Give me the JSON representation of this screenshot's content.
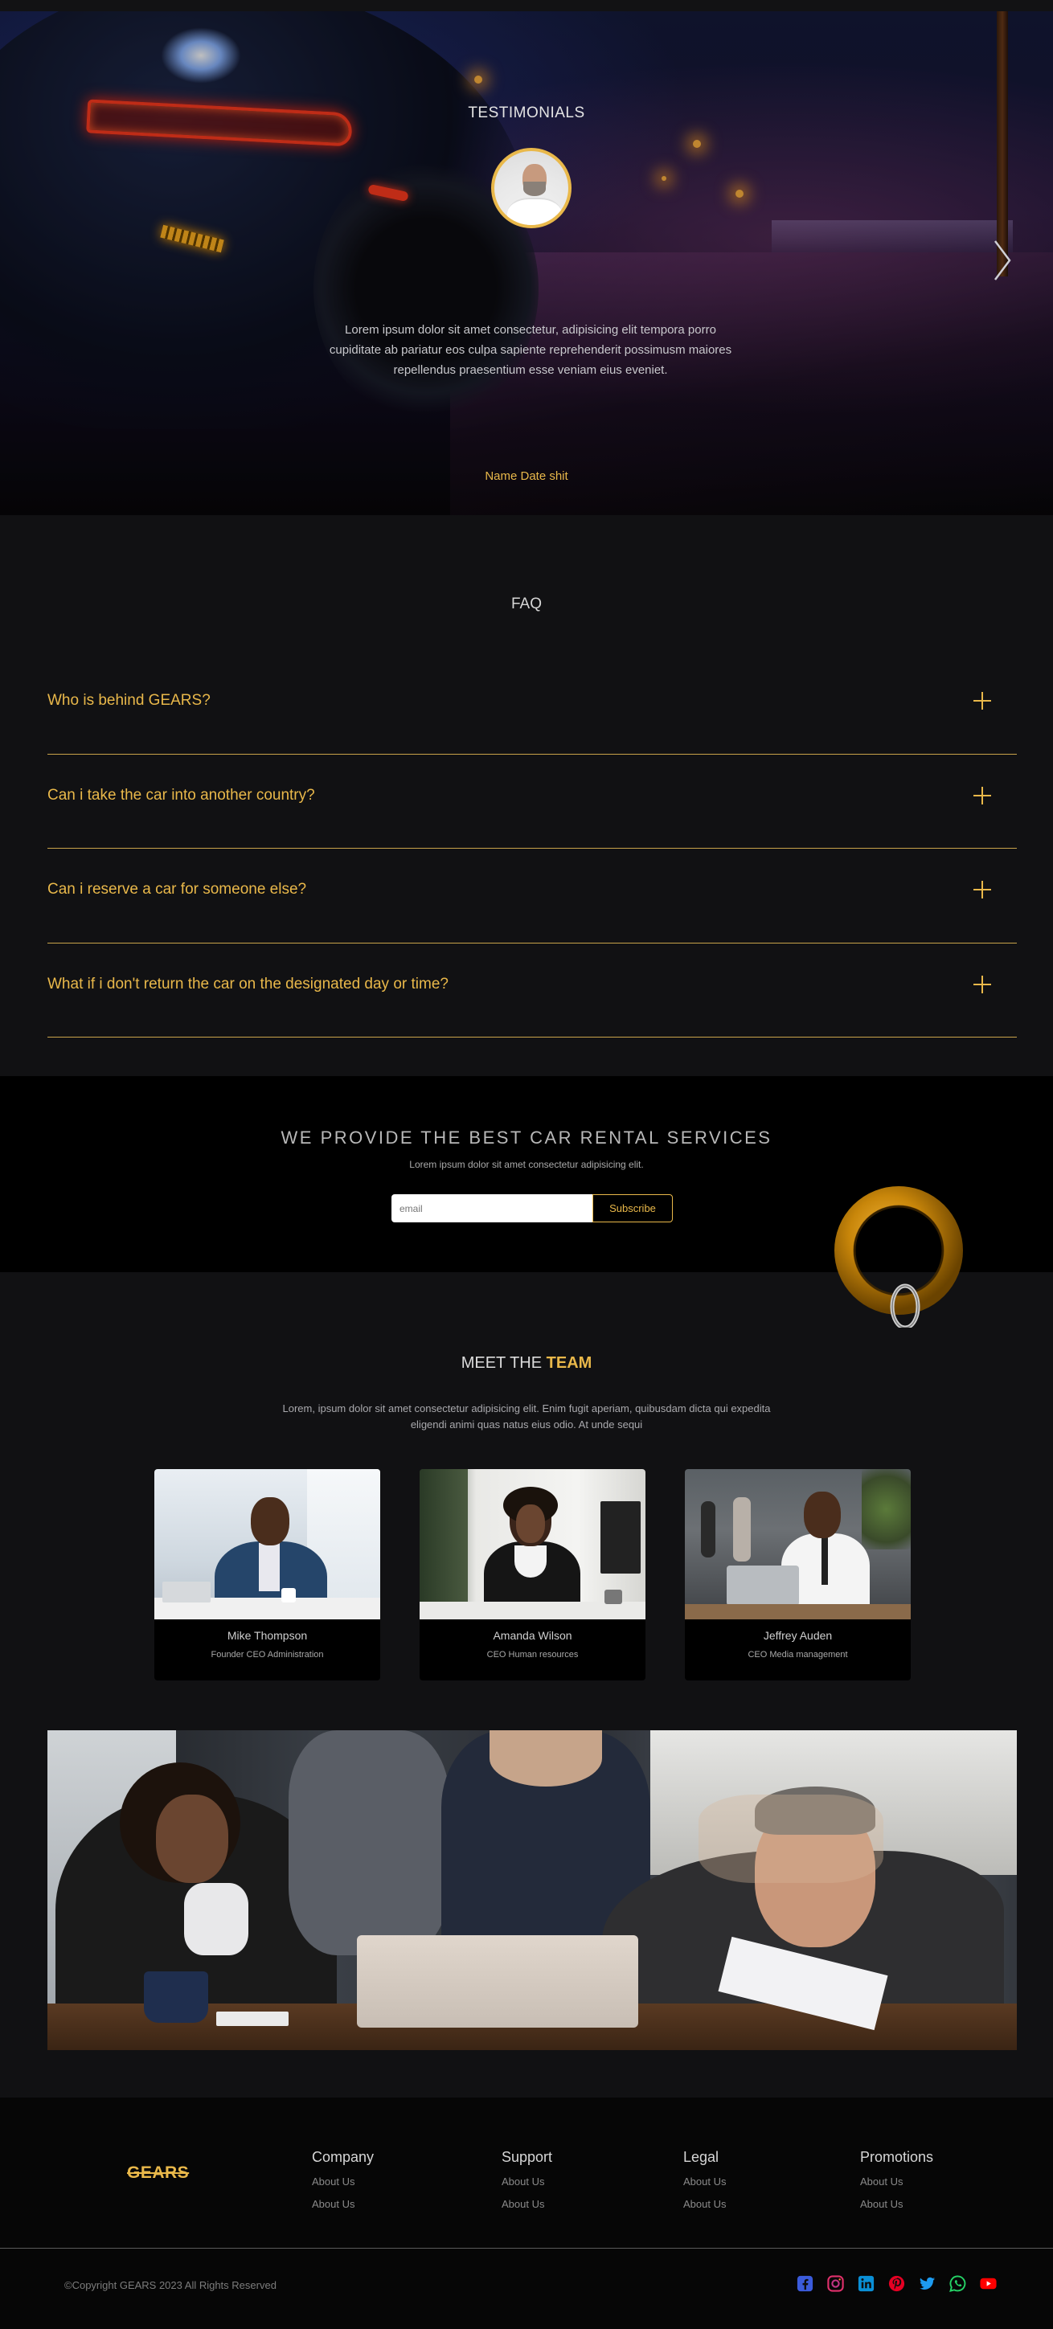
{
  "testimonials": {
    "title": "TESTIMONIALS",
    "quote": "Lorem ipsum dolor sit amet consectetur, adipisicing elit tempora porro cupiditate ab pariatur eos culpa sapiente reprehenderit possimusm maiores repellendus praesentium esse veniam eius eveniet.",
    "name": "Name Date shit"
  },
  "faq": {
    "title": "FAQ",
    "items": [
      {
        "question": "Who is behind GEARS?"
      },
      {
        "question": "Can i take the car into another country?"
      },
      {
        "question": "Can i reserve a car for someone else?"
      },
      {
        "question": "What if i don't return the car on the designated day or time?"
      }
    ]
  },
  "newsletter": {
    "title": "WE PROVIDE THE BEST CAR RENTAL SERVICES",
    "subtitle": "Lorem ipsum dolor sit amet consectetur adipisicing elit.",
    "email_placeholder": "email",
    "button_label": "Subscribe"
  },
  "team": {
    "title_prefix": "MEET THE",
    "title_highlight": "TEAM",
    "lead": "Lorem, ipsum dolor sit amet consectetur adipisicing elit. Enim fugit aperiam, quibusdam dicta qui expedita eligendi animi quas natus eius odio. At unde sequi",
    "members": [
      {
        "name": "Mike Thompson",
        "role": "Founder CEO Administration"
      },
      {
        "name": "Amanda Wilson",
        "role": "CEO Human resources"
      },
      {
        "name": "Jeffrey Auden",
        "role": "CEO Media management"
      }
    ]
  },
  "footer": {
    "brand": "GEARS",
    "columns": [
      {
        "title": "Company",
        "links": [
          "About Us",
          "About Us"
        ]
      },
      {
        "title": "Support",
        "links": [
          "About Us",
          "About Us"
        ]
      },
      {
        "title": "Legal",
        "links": [
          "About Us",
          "About Us"
        ]
      },
      {
        "title": "Promotions",
        "links": [
          "About Us",
          "About Us"
        ]
      }
    ],
    "copyright": "©Copyright GEARS 2023 All Rights Reserved",
    "socials": [
      "facebook-icon",
      "instagram-icon",
      "linkedin-icon",
      "pinterest-icon",
      "twitter-icon",
      "whatsapp-icon",
      "youtube-icon"
    ]
  },
  "colors": {
    "accent": "#e9b84a",
    "background": "#111113",
    "black": "#000000"
  }
}
